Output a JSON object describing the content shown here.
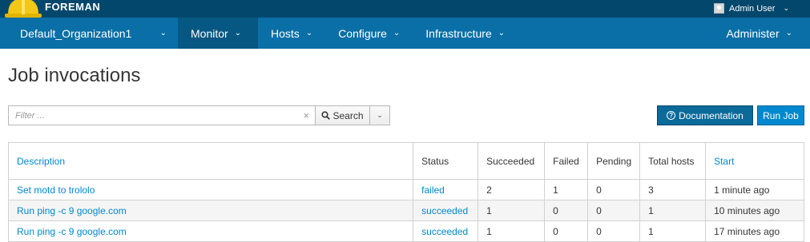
{
  "brand": {
    "name": "FOREMAN",
    "logo_icon": "hardhat-icon"
  },
  "user": {
    "name": "Admin User"
  },
  "nav": {
    "items": [
      {
        "label": "Default_Organization1"
      },
      {
        "label": "Monitor",
        "active": true
      },
      {
        "label": "Hosts"
      },
      {
        "label": "Configure"
      },
      {
        "label": "Infrastructure"
      }
    ],
    "right": {
      "label": "Administer"
    }
  },
  "page": {
    "title": "Job invocations"
  },
  "filter": {
    "placeholder": "Filter ...",
    "search_label": "Search"
  },
  "buttons": {
    "documentation": "Documentation",
    "run_job": "Run Job"
  },
  "table": {
    "headers": {
      "description": "Description",
      "status": "Status",
      "succeeded": "Succeeded",
      "failed": "Failed",
      "pending": "Pending",
      "total_hosts": "Total hosts",
      "start": "Start"
    },
    "rows": [
      {
        "description": "Set motd to trololo",
        "status": "failed",
        "succeeded": "2",
        "failed": "1",
        "pending": "0",
        "total_hosts": "3",
        "start": "1 minute ago"
      },
      {
        "description": "Run ping -c 9 google.com",
        "status": "succeeded",
        "succeeded": "1",
        "failed": "0",
        "pending": "0",
        "total_hosts": "1",
        "start": "10 minutes ago"
      },
      {
        "description": "Run ping -c 9 google.com",
        "status": "succeeded",
        "succeeded": "1",
        "failed": "0",
        "pending": "0",
        "total_hosts": "1",
        "start": "17 minutes ago"
      }
    ]
  },
  "colors": {
    "banner": "#04476c",
    "nav": "#0a6fa6",
    "link": "#0088ce"
  }
}
